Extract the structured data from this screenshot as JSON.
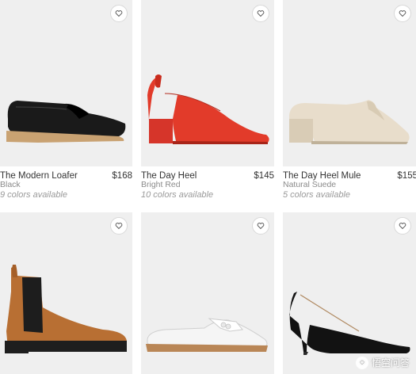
{
  "products": [
    {
      "name": "The Modern Loafer",
      "price": "$168",
      "color": "Black",
      "availability": "9 colors available",
      "icon": "heart-icon"
    },
    {
      "name": "The Day Heel",
      "price": "$145",
      "color": "Bright Red",
      "availability": "10 colors available",
      "icon": "heart-icon"
    },
    {
      "name": "The Day Heel Mule",
      "price": "$155",
      "color": "Natural Suede",
      "availability": "5 colors available",
      "icon": "heart-icon"
    },
    {
      "name": "",
      "price": "",
      "color": "",
      "availability": "",
      "icon": "heart-icon"
    },
    {
      "name": "",
      "price": "",
      "color": "",
      "availability": "",
      "icon": "heart-icon"
    },
    {
      "name": "",
      "price": "",
      "color": "",
      "availability": "",
      "icon": "heart-icon"
    }
  ],
  "watermark": {
    "text": "悟空问答"
  },
  "colors": {
    "background": "#efefef",
    "text": "#333333",
    "muted": "#9a9a9a"
  }
}
